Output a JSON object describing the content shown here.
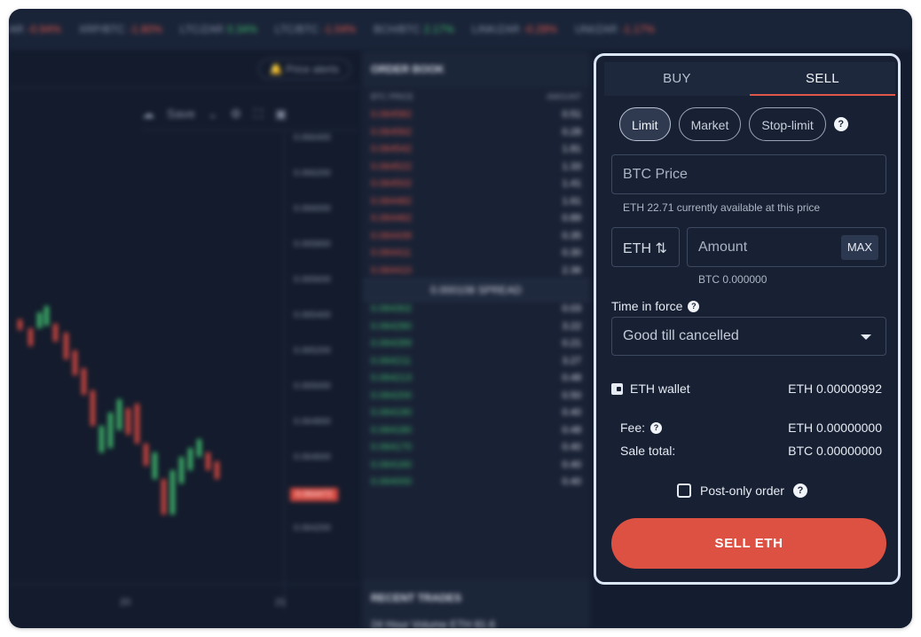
{
  "ticker": [
    {
      "pair": "AR",
      "change": "-0.94%",
      "dir": "neg"
    },
    {
      "pair": "XRP/BTC",
      "change": "-1.80%",
      "dir": "neg"
    },
    {
      "pair": "LTC/ZAR",
      "change": "0.34%",
      "dir": "pos"
    },
    {
      "pair": "LTC/BTC",
      "change": "-1.04%",
      "dir": "neg"
    },
    {
      "pair": "BCH/BTC",
      "change": "2.17%",
      "dir": "pos"
    },
    {
      "pair": "LINK/ZAR",
      "change": "-0.28%",
      "dir": "neg"
    },
    {
      "pair": "UNI/ZAR",
      "change": "-1.17%",
      "dir": "neg"
    }
  ],
  "chart": {
    "price_alerts": "Price alerts",
    "save": "Save",
    "y_ticks": [
      "0.066400",
      "0.066200",
      "0.066000",
      "0.065800",
      "0.065600",
      "0.065400",
      "0.065200",
      "0.065000",
      "0.064800",
      "0.064600",
      "0.064472",
      "0.064200"
    ],
    "x_ticks": [
      "20",
      "21"
    ]
  },
  "orderbook": {
    "title": "ORDER BOOK",
    "col_price": "BTC PRICE",
    "col_amount": "AMOUNT",
    "asks": [
      [
        "0.064582",
        "0.51"
      ],
      [
        "0.064562",
        "0.28"
      ],
      [
        "0.064542",
        "1.81"
      ],
      [
        "0.064522",
        "1.33"
      ],
      [
        "0.064502",
        "1.41"
      ],
      [
        "0.064482",
        "1.61"
      ],
      [
        "0.064462",
        "0.89"
      ],
      [
        "0.064439",
        "0.35"
      ],
      [
        "0.064411",
        "0.30"
      ],
      [
        "0.064410",
        "2.36"
      ]
    ],
    "spread": "0.000108 SPREAD",
    "bids": [
      [
        "0.064302",
        "0.03"
      ],
      [
        "0.064280",
        "3.22"
      ],
      [
        "0.064289",
        "0.21"
      ],
      [
        "0.064211",
        "3.27"
      ],
      [
        "0.064213",
        "0.48"
      ],
      [
        "0.064200",
        "0.50"
      ],
      [
        "0.064190",
        "0.40"
      ],
      [
        "0.064180",
        "0.48"
      ],
      [
        "0.064170",
        "0.40"
      ],
      [
        "0.064160",
        "0.40"
      ],
      [
        "0.064000",
        "0.40"
      ]
    ],
    "recent_trades": "RECENT TRADES",
    "volume": "24 Hour Volume ETH 81.6"
  },
  "form": {
    "tabs": [
      "BUY",
      "SELL"
    ],
    "active_tab": "SELL",
    "order_types": [
      "Limit",
      "Market",
      "Stop-limit"
    ],
    "active_order_type": "Limit",
    "price_label": "BTC  Price",
    "price_hint": "ETH 22.71 currently available at this price",
    "unit": "ETH",
    "amount_placeholder": "Amount",
    "max_label": "MAX",
    "amount_btc": "BTC 0.000000",
    "time_in_force_label": "Time in force",
    "time_in_force_value": "Good till cancelled",
    "wallet_label": "ETH wallet",
    "wallet_balance": "ETH 0.00000992",
    "fee_label": "Fee:",
    "fee_value": "ETH  0.00000000",
    "sale_total_label": "Sale total:",
    "sale_total_value": "BTC  0.00000000",
    "post_only_label": "Post-only order",
    "submit_label": "SELL ETH"
  },
  "colors": {
    "accent": "#dd5143",
    "positive": "#3fb96c",
    "negative": "#e0574a",
    "panel_border": "#dbe6f6"
  }
}
